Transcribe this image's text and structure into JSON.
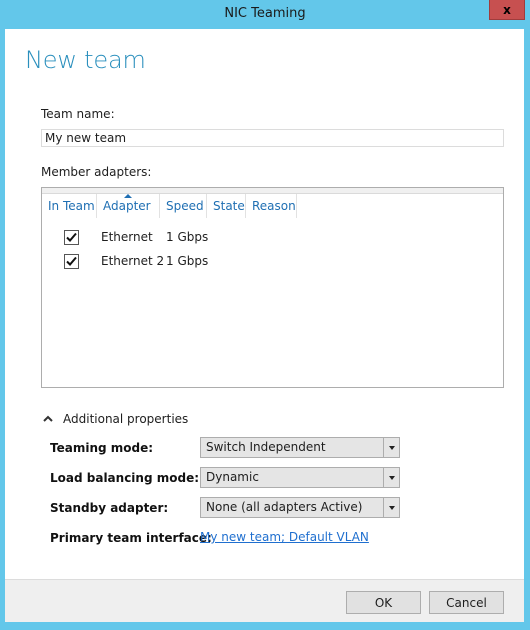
{
  "window": {
    "title": "NIC Teaming",
    "close_label": "x"
  },
  "page": {
    "heading": "New team"
  },
  "team_name": {
    "label": "Team name:",
    "value": "My new team"
  },
  "member_adapters": {
    "label": "Member adapters:",
    "columns": [
      {
        "label": "In Team",
        "sorted": false
      },
      {
        "label": "Adapter",
        "sorted": true,
        "sort_direction": "ascending"
      },
      {
        "label": "Speed",
        "sorted": false
      },
      {
        "label": "State",
        "sorted": false
      },
      {
        "label": "Reason",
        "sorted": false
      }
    ],
    "rows": [
      {
        "in_team": true,
        "adapter": "Ethernet",
        "speed": "1 Gbps",
        "state": "",
        "reason": ""
      },
      {
        "in_team": true,
        "adapter": "Ethernet 2",
        "speed": "1 Gbps",
        "state": "",
        "reason": ""
      }
    ]
  },
  "additional_properties": {
    "label": "Additional properties",
    "expanded": true,
    "teaming_mode": {
      "label": "Teaming mode:",
      "value": "Switch Independent"
    },
    "load_balancing_mode": {
      "label": "Load balancing mode:",
      "value": "Dynamic"
    },
    "standby_adapter": {
      "label": "Standby adapter:",
      "value": "None (all adapters Active)"
    },
    "primary_team_interface": {
      "label": "Primary team interface:",
      "value": "My new team; Default VLAN"
    }
  },
  "footer": {
    "ok_label": "OK",
    "cancel_label": "Cancel"
  },
  "colors": {
    "frame": "#63c7ea",
    "accent": "#2a8fbd",
    "link": "#1f6fcf",
    "close": "#c75050"
  }
}
